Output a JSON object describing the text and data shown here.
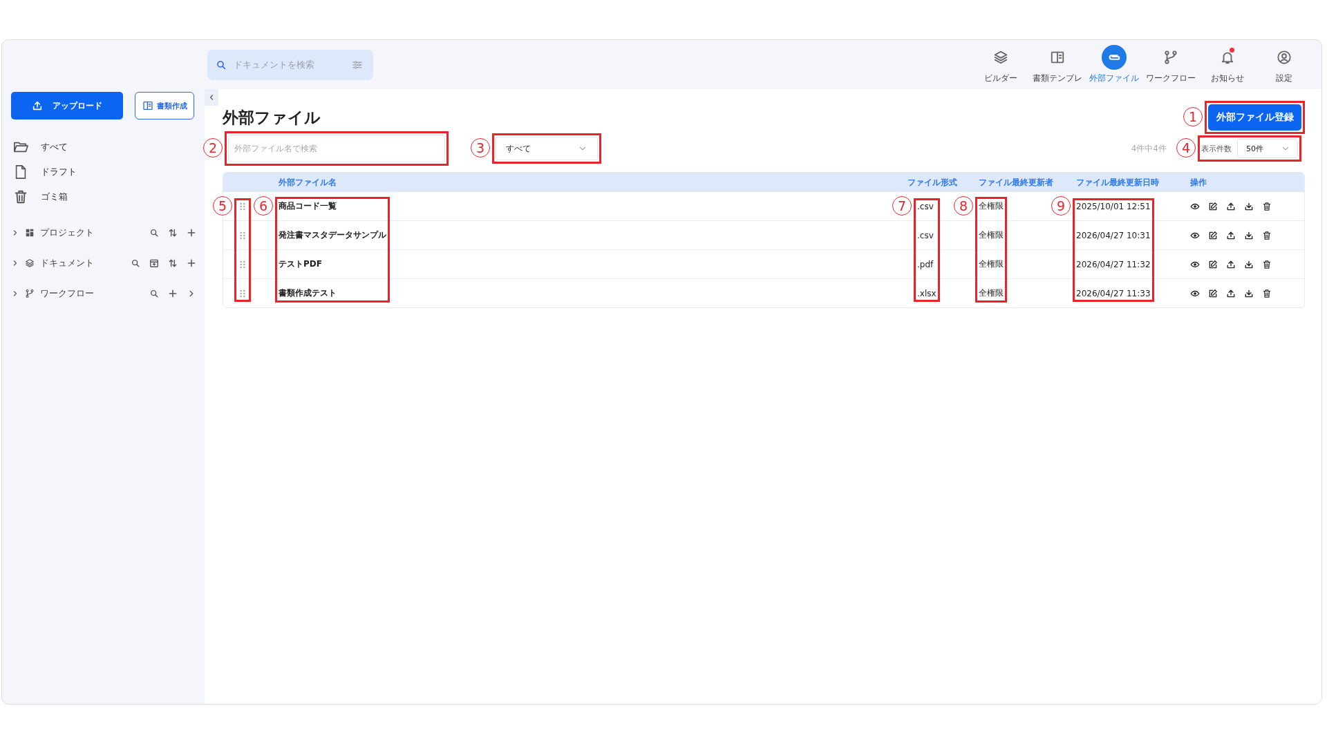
{
  "top_search": {
    "placeholder": "ドキュメントを検索"
  },
  "nav": [
    {
      "label": "ビルダー",
      "selected": false
    },
    {
      "label": "書類テンプレ",
      "selected": false
    },
    {
      "label": "外部ファイル",
      "selected": true
    },
    {
      "label": "ワークフロー",
      "selected": false
    },
    {
      "label": "お知らせ",
      "selected": false,
      "unread": true
    },
    {
      "label": "設定",
      "selected": false
    }
  ],
  "sidebar": {
    "upload_button": "アップロード",
    "create_button": "書類作成",
    "items": [
      {
        "label": "すべて"
      },
      {
        "label": "ドラフト"
      },
      {
        "label": "ゴミ箱"
      }
    ],
    "sections": [
      {
        "label": "プロジェクト",
        "expanded": false
      },
      {
        "label": "ドキュメント",
        "expanded": false
      },
      {
        "label": "ワークフロー",
        "expanded": false
      }
    ]
  },
  "page": {
    "title": "外部ファイル",
    "register_button": {
      "label": "外部ファイル登録",
      "callout": "1"
    },
    "search": {
      "placeholder": "外部ファイル名で検索",
      "callout": "2"
    },
    "filter": {
      "value": "すべて",
      "callout": "3"
    },
    "count": "4件中4件",
    "page_size": {
      "label": "表示件数",
      "value": "50件",
      "callout": "4"
    }
  },
  "table": {
    "handle_column": {
      "callout": "5"
    },
    "columns": [
      {
        "label": "外部ファイル名",
        "callout": "6"
      },
      {
        "label": "ファイル形式",
        "callout": "7"
      },
      {
        "label": "ファイル最終更新者",
        "callout": "8"
      },
      {
        "label": "ファイル最終更新日時",
        "callout": "9"
      },
      {
        "label": "操作"
      }
    ],
    "rows": [
      {
        "name": "商品コード一覧",
        "format": ".csv",
        "updater": "全権限",
        "updated": "2025/10/01 12:51"
      },
      {
        "name": "発注書マスタデータサンプル",
        "format": ".csv",
        "updater": "全権限",
        "updated": "2026/04/27 10:31"
      },
      {
        "name": "テストPDF",
        "format": ".pdf",
        "updater": "全権限",
        "updated": "2026/04/27 11:32"
      },
      {
        "name": "書類作成テスト",
        "format": ".xlsx",
        "updater": "全権限",
        "updated": "2026/04/27 11:33"
      }
    ]
  }
}
